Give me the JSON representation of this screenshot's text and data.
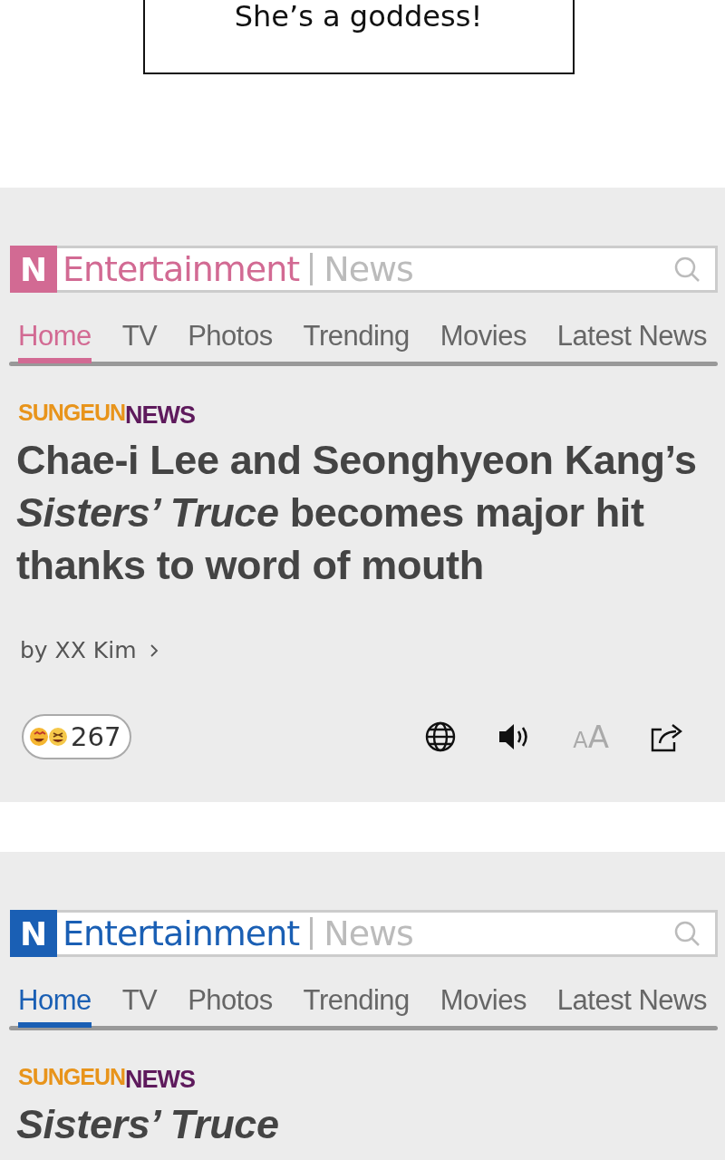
{
  "speech_bubble": {
    "text": "She’s a goddess!"
  },
  "panels": [
    {
      "color": "#d26a93",
      "brand_mark": "N",
      "brand": "Entertainment",
      "section": "News",
      "tabs": [
        {
          "label": "Home",
          "selected": true
        },
        {
          "label": "TV",
          "selected": false
        },
        {
          "label": "Photos",
          "selected": false
        },
        {
          "label": "Trending",
          "selected": false
        },
        {
          "label": "Movies",
          "selected": false
        },
        {
          "label": "Latest News",
          "selected": false
        }
      ],
      "publisher": [
        "SUNGEUN",
        "NEWS"
      ],
      "headline": "Chae-i Lee and Seonghyeon Kang’s *Sisters’ Truce* becomes major hit thanks to word of mouth",
      "byline": "by XX Kim",
      "reactions": {
        "count": "267"
      },
      "toolbar": [
        {
          "kind": "globe"
        },
        {
          "kind": "sound"
        },
        {
          "kind": "font_size",
          "label": "AA"
        },
        {
          "kind": "share"
        }
      ]
    },
    {
      "color": "#1a5fb4",
      "brand_mark": "N",
      "brand": "Entertainment",
      "section": "News",
      "tabs": [
        {
          "label": "Home",
          "selected": true
        },
        {
          "label": "TV",
          "selected": false
        },
        {
          "label": "Photos",
          "selected": false
        },
        {
          "label": "Trending",
          "selected": false
        },
        {
          "label": "Movies",
          "selected": false
        },
        {
          "label": "Latest News",
          "selected": false
        }
      ],
      "publisher": [
        "SUNGEUN",
        "NEWS"
      ],
      "headline": "*Sisters’ Truce*"
    }
  ]
}
